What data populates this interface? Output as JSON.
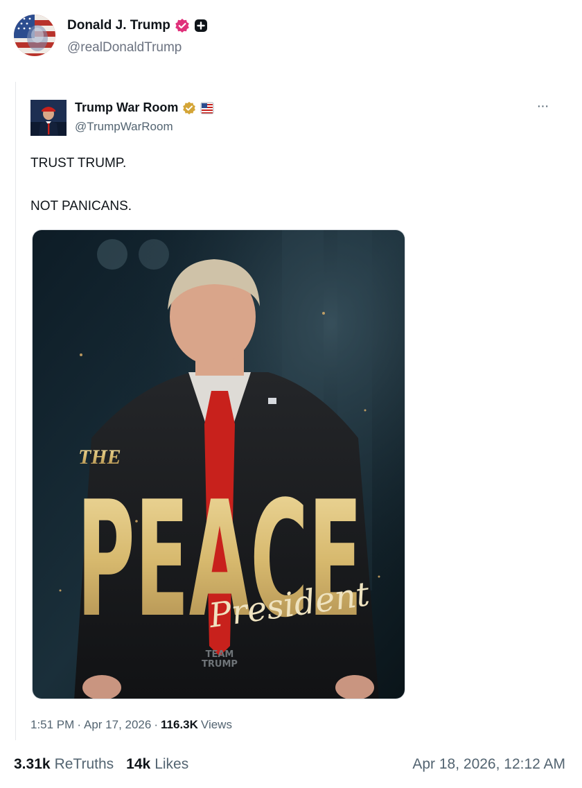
{
  "author": {
    "name": "Donald J. Trump",
    "handle": "@realDonaldTrump"
  },
  "quoted_post": {
    "author_name": "Trump War Room",
    "author_handle": "@TrumpWarRoom",
    "more_label": "···",
    "text_line_1": "TRUST TRUMP.",
    "text_line_2": "NOT PANICANS.",
    "image": {
      "headline_small": "THE",
      "headline_big": "PEACE",
      "headline_script": "President",
      "watermark_line_1": "TEAM",
      "watermark_line_2": "TRUMP"
    },
    "time": "1:51 PM",
    "date": "Apr 17, 2026",
    "separator": "·",
    "views_count": "116.3K",
    "views_label": "Views"
  },
  "stats": {
    "retruths_count": "3.31k",
    "retruths_label": "ReTruths",
    "likes_count": "14k",
    "likes_label": "Likes",
    "posted_at": "Apr 18, 2026, 12:12 AM"
  },
  "colors": {
    "verified_badge": "#e0307a",
    "gold_badge": "#d4a537",
    "tie_red": "#c8211c",
    "gold_text": "#d9bf7a"
  },
  "icons": [
    "verified-badge-icon",
    "plus-badge-icon",
    "gold-verified-badge-icon",
    "flag-badge-icon",
    "more-options-icon"
  ]
}
